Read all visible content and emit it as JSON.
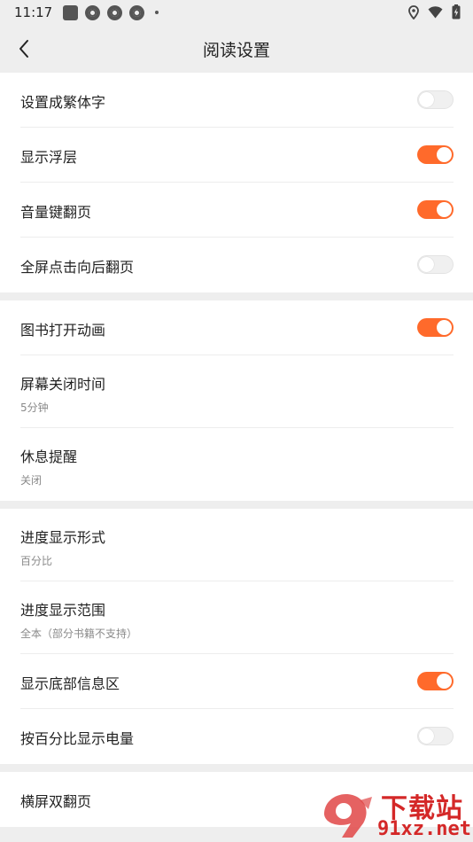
{
  "status_bar": {
    "time": "11:17"
  },
  "header": {
    "title": "阅读设置"
  },
  "colors": {
    "accent": "#ff6a2b",
    "background": "#eeeeee",
    "card": "#ffffff"
  },
  "groups": [
    {
      "items": [
        {
          "label": "设置成繁体字",
          "toggle": false
        },
        {
          "label": "显示浮层",
          "toggle": true
        },
        {
          "label": "音量键翻页",
          "toggle": true
        },
        {
          "label": "全屏点击向后翻页",
          "toggle": false
        }
      ]
    },
    {
      "items": [
        {
          "label": "图书打开动画",
          "toggle": true
        },
        {
          "label": "屏幕关闭时间",
          "value": "5分钟"
        },
        {
          "label": "休息提醒",
          "value": "关闭"
        }
      ]
    },
    {
      "items": [
        {
          "label": "进度显示形式",
          "value": "百分比"
        },
        {
          "label": "进度显示范围",
          "value": "全本（部分书籍不支持）"
        },
        {
          "label": "显示底部信息区",
          "toggle": true
        },
        {
          "label": "按百分比显示电量",
          "toggle": false
        }
      ]
    },
    {
      "items": [
        {
          "label": "横屏双翻页"
        }
      ]
    }
  ],
  "watermark": {
    "top": "下载站",
    "bottom": "91xz.net"
  }
}
